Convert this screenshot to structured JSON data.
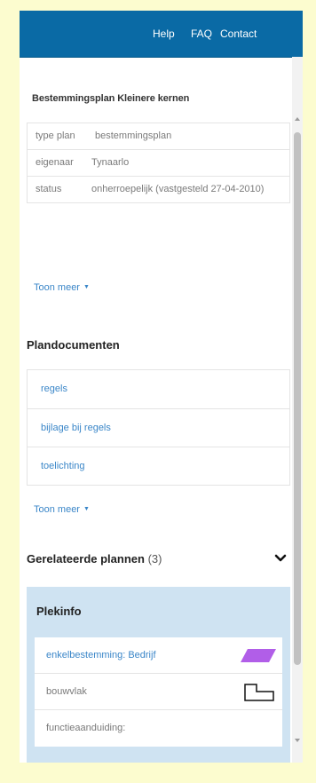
{
  "nav": {
    "help": "Help",
    "faq": "FAQ",
    "contact": "Contact"
  },
  "plan": {
    "title": "Bestemmingsplan Kleinere kernen",
    "properties": [
      {
        "key": "type plan",
        "value": "bestemmingsplan"
      },
      {
        "key": "eigenaar",
        "value": "Tynaarlo"
      },
      {
        "key": "status",
        "value": "onherroepelijk (vastgesteld 27-04-2010)"
      }
    ],
    "toon_meer": "Toon meer"
  },
  "plandocumenten": {
    "title": "Plandocumenten",
    "items": [
      "regels",
      "bijlage bij regels",
      "toelichting"
    ],
    "toon_meer": "Toon meer"
  },
  "gerelateerde": {
    "title": "Gerelateerde plannen",
    "count": "(3)"
  },
  "plekinfo": {
    "title": "Plekinfo",
    "items": [
      {
        "label": "enkelbestemming: Bedrijf",
        "swatch_color": "#b15ee8"
      },
      {
        "label": "bouwvlak",
        "swatch_color": "#000000"
      },
      {
        "label": "functieaanduiding:",
        "swatch_color": ""
      }
    ]
  },
  "colors": {
    "topbar": "#0a6aa5",
    "link": "#3a86c8",
    "plekinfo_bg": "#cfe3f2",
    "page_bg": "#fcfccf"
  }
}
